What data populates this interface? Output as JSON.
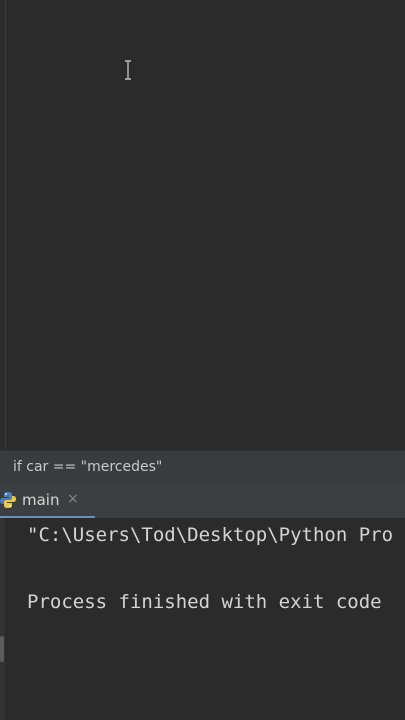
{
  "breadcrumb": {
    "text": "if car == \"mercedes\""
  },
  "run_panel": {
    "tab_label": "main",
    "tab_close": "×"
  },
  "console": {
    "lines": [
      "\"C:\\Users\\Tod\\Desktop\\Python Pro",
      "Process finished with exit code"
    ]
  },
  "colors": {
    "editor_bg": "#2b2b2b",
    "panel_bg": "#3c3f41",
    "active_tab_underline": "#6f8fb6",
    "console_text": "#d4d4d4"
  },
  "icons": [
    "text-cursor-icon",
    "python-icon",
    "close-icon"
  ]
}
